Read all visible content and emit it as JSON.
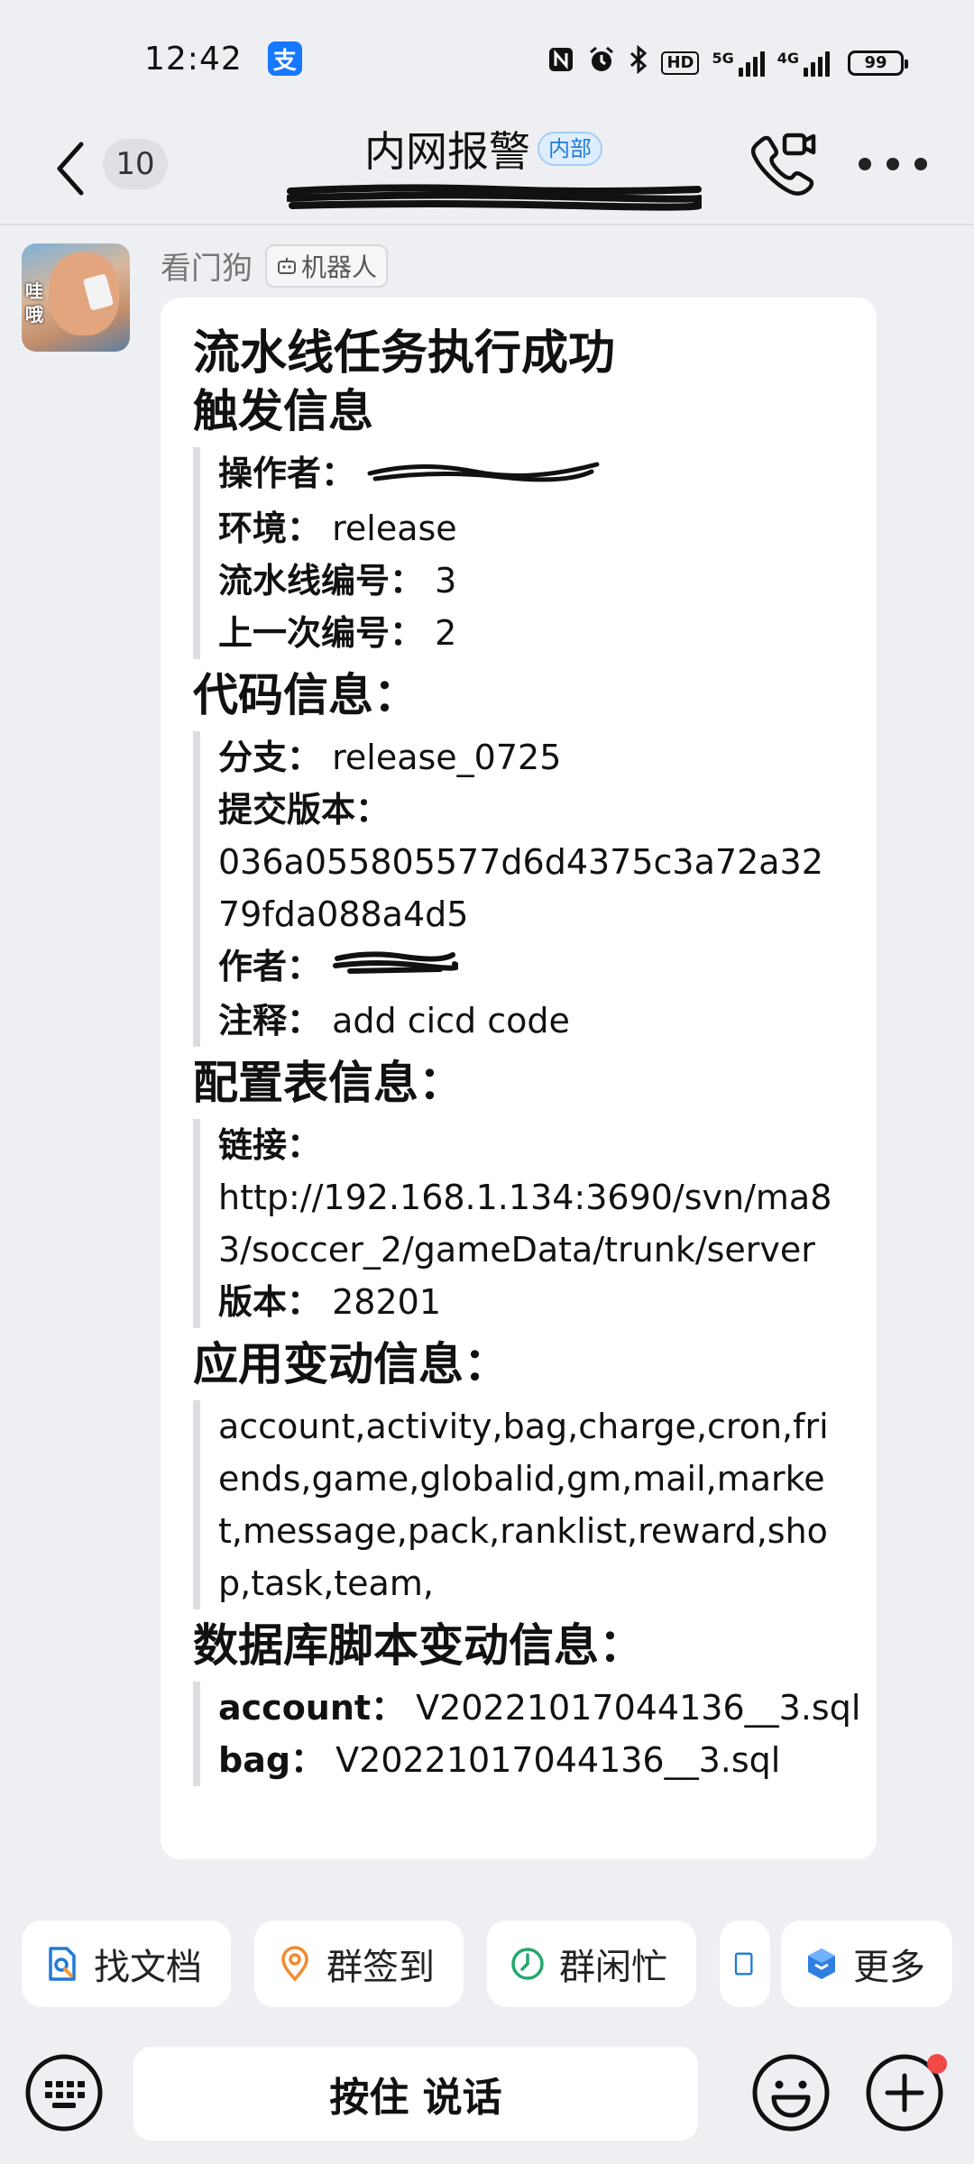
{
  "status_bar": {
    "time": "12:42",
    "app_icon_label": "支",
    "icons": [
      "nfc-icon",
      "alarm-icon",
      "bluetooth-icon",
      "hd-icon",
      "5g-signal-icon",
      "4g-signal-icon"
    ],
    "hd_label": "HD",
    "net1_label": "5G",
    "net2_label": "4G",
    "battery": "99"
  },
  "nav": {
    "unread_count": "10",
    "title": "内网报警",
    "tag": "内部"
  },
  "message": {
    "sender": "看门狗",
    "sender_tag": "机器人",
    "avatar_text": "哇哦",
    "title": "流水线任务执行成功",
    "sections": {
      "trigger": {
        "heading": "触发信息",
        "operator_label": "操作者：",
        "env_label": "环境：",
        "env_value": "release",
        "pipeline_no_label": "流水线编号：",
        "pipeline_no_value": "3",
        "prev_no_label": "上一次编号：",
        "prev_no_value": "2"
      },
      "code": {
        "heading": "代码信息：",
        "branch_label": "分支：",
        "branch_value": "release_0725",
        "commit_label": "提交版本：",
        "commit_value": "036a055805577d6d4375c3a72a3279fda088a4d5",
        "author_label": "作者：",
        "note_label": "注释：",
        "note_value": "add cicd code"
      },
      "config": {
        "heading": "配置表信息：",
        "link_label": "链接：",
        "link_value": "http://192.168.1.134:3690/svn/ma83/soccer_2/gameData/trunk/server",
        "version_label": "版本：",
        "version_value": "28201"
      },
      "apps": {
        "heading": "应用变动信息：",
        "value": "account,activity,bag,charge,cron,friends,game,globalid,gm,mail,market,message,pack,ranklist,reward,shop,task,team,"
      },
      "db": {
        "heading": "数据库脚本变动信息：",
        "row1_label": "account：",
        "row1_value": "V20221017044136__3.sql",
        "row2_label": "bag：",
        "row2_value": "V20221017044136__3.sql"
      }
    }
  },
  "quick_actions": [
    {
      "label": "找文档",
      "icon": "doc-search-icon"
    },
    {
      "label": "群签到",
      "icon": "checkin-icon"
    },
    {
      "label": "群闲忙",
      "icon": "clock-icon"
    },
    {
      "label": "更多",
      "icon": "more-apps-icon"
    }
  ],
  "input_bar": {
    "voice_label": "按住 说话"
  },
  "colors": {
    "background": "#eeeff3",
    "bubble": "#ffffff",
    "accent_blue": "#1f7ad8",
    "notification_red": "#f24848"
  }
}
